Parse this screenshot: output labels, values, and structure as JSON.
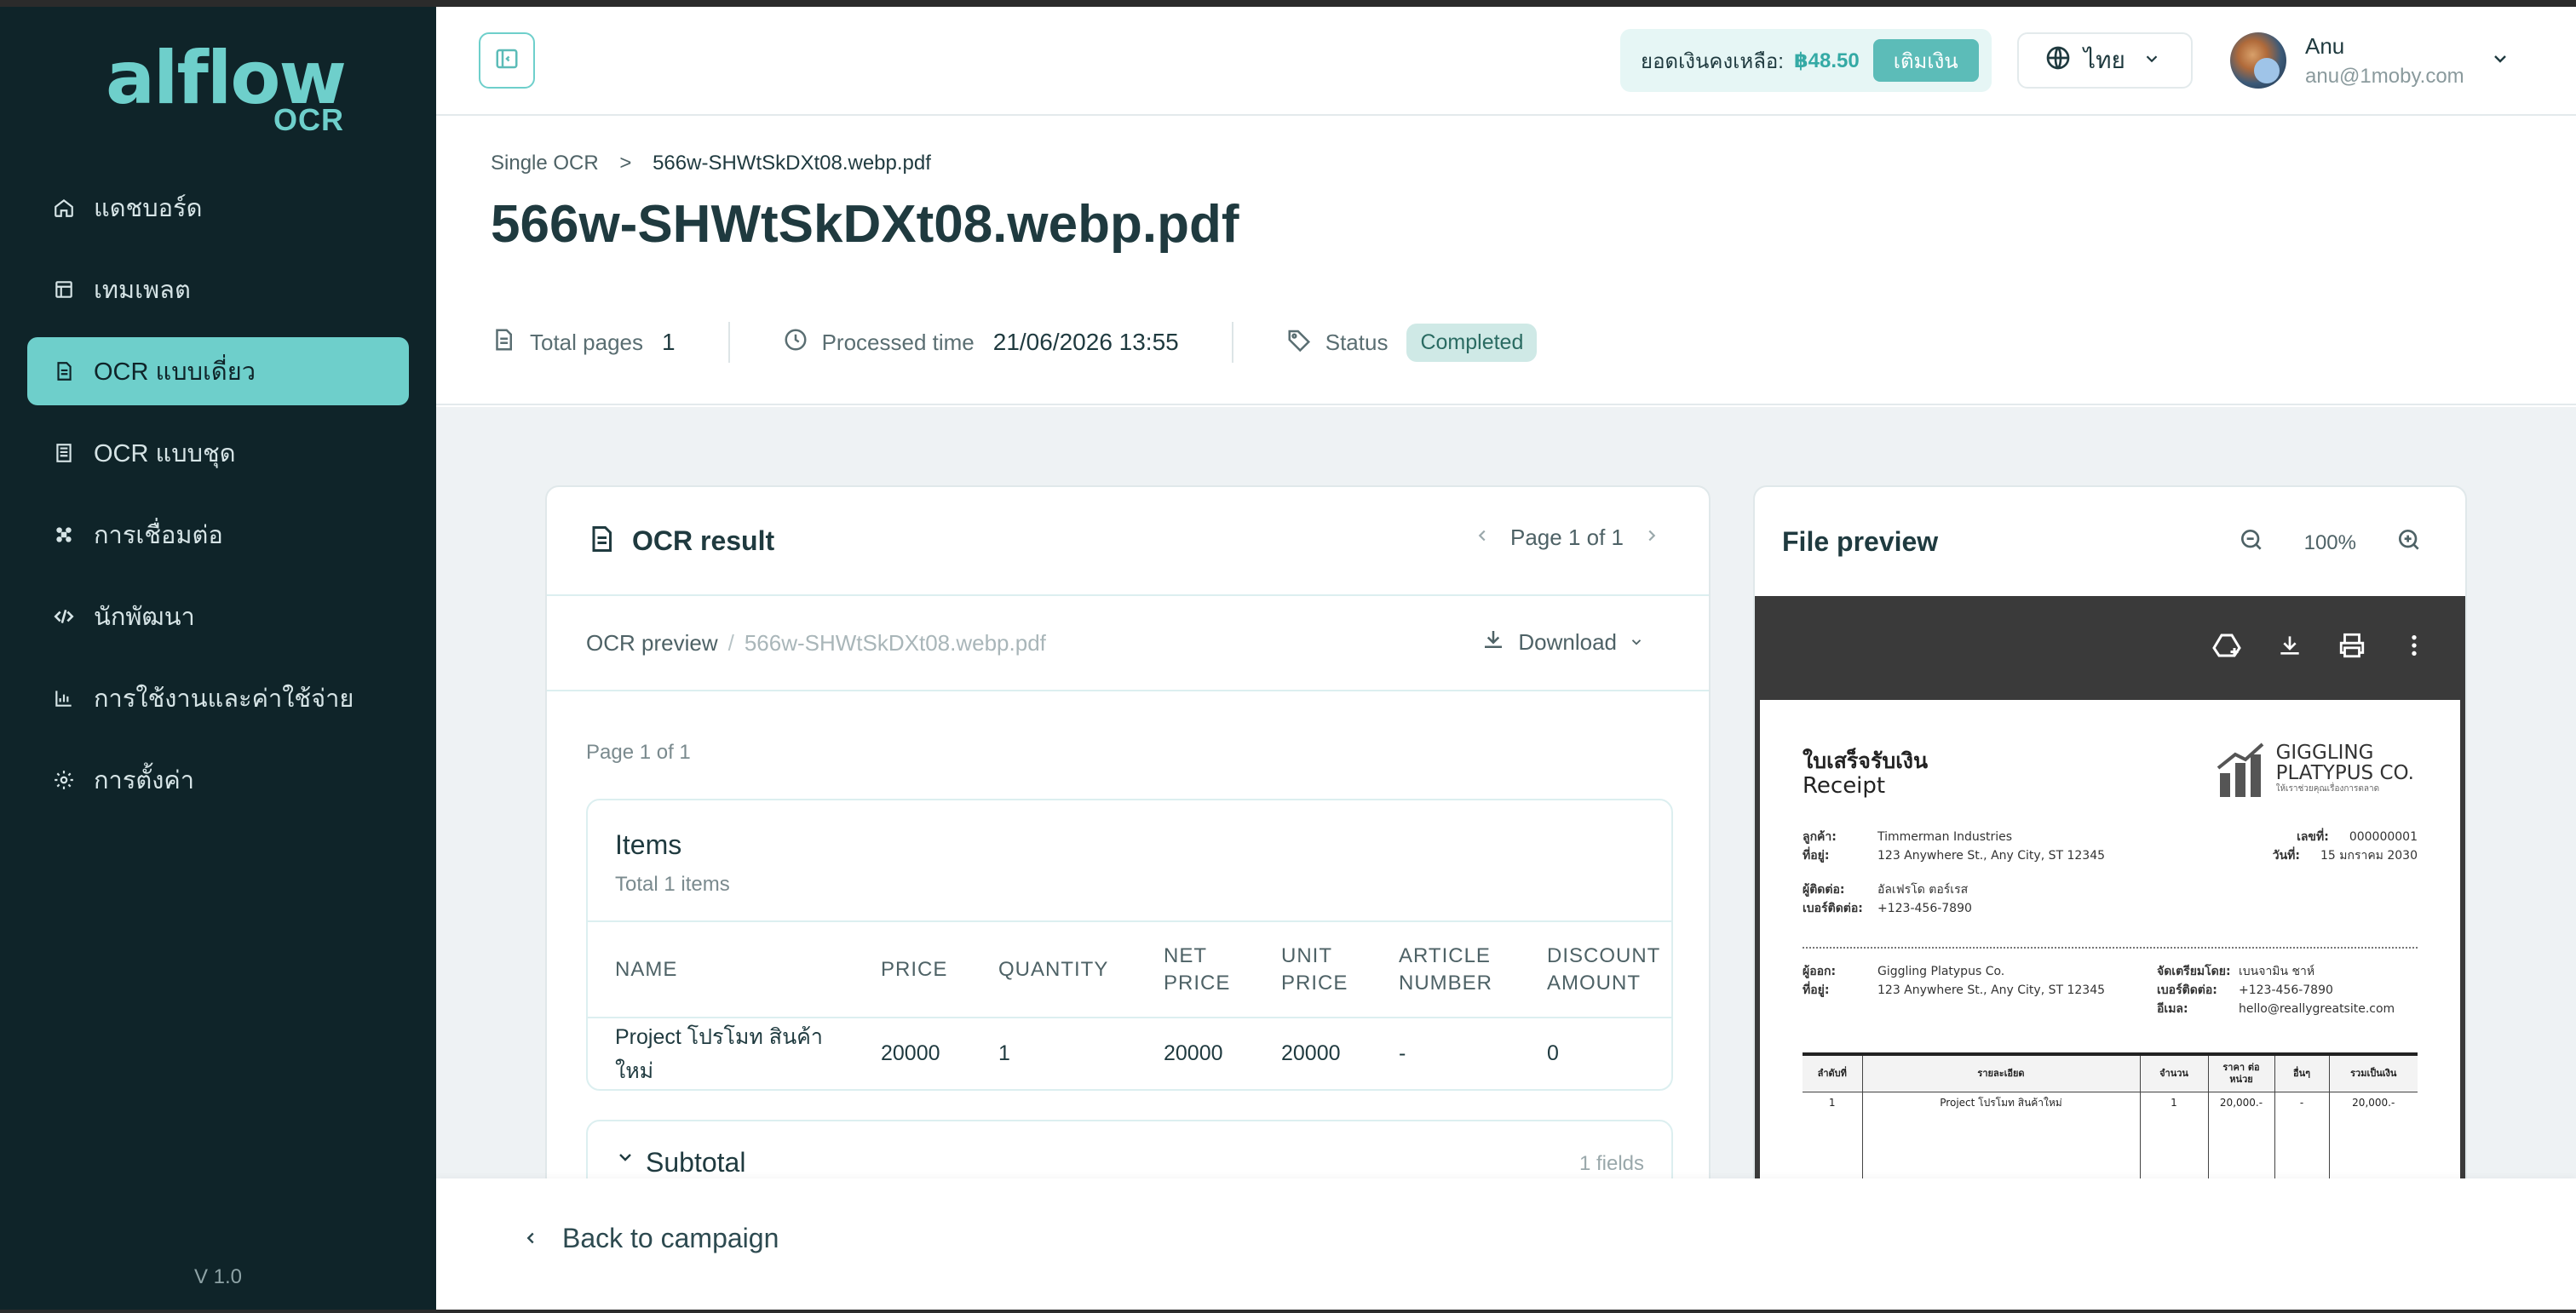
{
  "brand": {
    "logo_main": "alflow",
    "logo_sub": "OCR"
  },
  "sidebar": {
    "items": [
      {
        "label": "แดชบอร์ด",
        "icon": "home-icon"
      },
      {
        "label": "เทมเพลต",
        "icon": "template-icon"
      },
      {
        "label": "OCR แบบเดี่ยว",
        "icon": "document-icon",
        "active": true
      },
      {
        "label": "OCR แบบชุด",
        "icon": "batch-icon"
      },
      {
        "label": "การเชื่อมต่อ",
        "icon": "integration-icon"
      },
      {
        "label": "นักพัฒนา",
        "icon": "code-icon"
      },
      {
        "label": "การใช้งานและค่าใช้จ่าย",
        "icon": "chart-icon"
      },
      {
        "label": "การตั้งค่า",
        "icon": "gear-icon"
      }
    ],
    "version": "V 1.0"
  },
  "topbar": {
    "balance_label": "ยอดเงินคงเหลือ:",
    "balance_amount": "฿48.50",
    "topup_label": "เติมเงิน",
    "language": "ไทย",
    "user_name": "Anu",
    "user_email": "anu@1moby.com"
  },
  "header": {
    "breadcrumb_parent": "Single OCR",
    "breadcrumb_sep": ">",
    "breadcrumb_current": "566w-SHWtSkDXt08.webp.pdf",
    "title": "566w-SHWtSkDXt08.webp.pdf",
    "total_pages_label": "Total pages",
    "total_pages_value": "1",
    "processed_label": "Processed time",
    "processed_value": "21/06/2026 13:55",
    "status_label": "Status",
    "status_value": "Completed"
  },
  "ocr": {
    "title": "OCR result",
    "pager": "Page 1 of 1",
    "preview_label": "OCR preview",
    "preview_sep": "/",
    "preview_file": "566w-SHWtSkDXt08.webp.pdf",
    "download_label": "Download",
    "page_indicator": "Page 1 of 1",
    "items_title": "Items",
    "items_count": "Total 1 items",
    "columns": [
      "NAME",
      "PRICE",
      "QUANTITY",
      "NET PRICE",
      "UNIT PRICE",
      "ARTICLE NUMBER",
      "DISCOUNT AMOUNT"
    ],
    "rows": [
      [
        "Project โปรโมท สินค้าใหม่",
        "20000",
        "1",
        "20000",
        "20000",
        "-",
        "0"
      ]
    ],
    "subtotal_title": "Subtotal",
    "subtotal_fields": "1 fields"
  },
  "preview": {
    "title": "File preview",
    "zoom": "100%",
    "doc": {
      "title_th": "ใบเสร็จรับเงิน",
      "title_en": "Receipt",
      "company_line1": "GIGGLING",
      "company_line2": "PLATYPUS CO.",
      "company_tagline": "ให้เราช่วยคุณเรื่องการตลาด",
      "customer_label": "ลูกค้า:",
      "customer_value": "Timmerman Industries",
      "address_label": "ที่อยู่:",
      "address_value": "123 Anywhere St., Any City, ST 12345",
      "contact_label": "ผู้ติดต่อ:",
      "contact_value": "อัลเฟรโด ตอร์เรส",
      "phone_label": "เบอร์ติดต่อ:",
      "phone_value": "+123-456-7890",
      "number_label": "เลขที่:",
      "number_value": "000000001",
      "date_label": "วันที่:",
      "date_value": "15 มกราคม 2030",
      "issuer_label": "ผู้ออก:",
      "issuer_value": "Giggling Platypus Co.",
      "issuer_address_label": "ที่อยู่:",
      "issuer_address_value": "123 Anywhere St., Any City, ST 12345",
      "prepared_label": "จัดเตรียมโดย:",
      "prepared_value": "เบนจามิน ชาห์",
      "prepared_phone_label": "เบอร์ติดต่อ:",
      "prepared_phone_value": "+123-456-7890",
      "email_label": "อีเมล:",
      "email_value": "hello@reallygreatsite.com",
      "table_headers": [
        "ลำดับที่",
        "รายละเอียด",
        "จำนวน",
        "ราคา ต่อหน่วย",
        "อื่นๆ",
        "รวมเป็นเงิน"
      ],
      "table_row": [
        "1",
        "Project โปรโมท สินค้าใหม่",
        "1",
        "20,000.-",
        "-",
        "20,000.-"
      ]
    }
  },
  "footer": {
    "back_label": "Back to campaign"
  }
}
